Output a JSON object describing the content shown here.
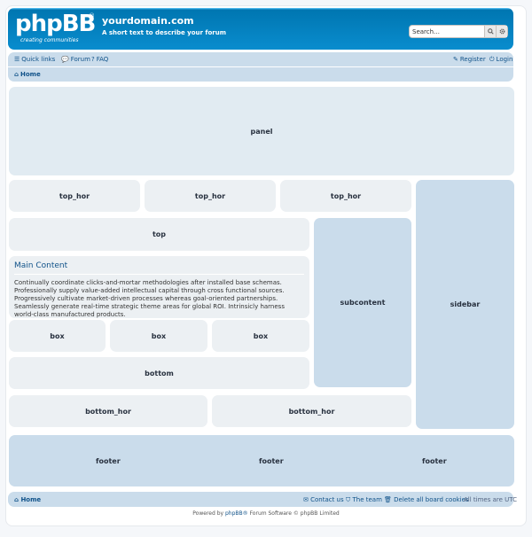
{
  "header": {
    "logo_text": "phpBB",
    "logo_reg": "®",
    "logo_tagline": "creating communities",
    "site_title": "yourdomain.com",
    "site_description": "A short text to describe your forum",
    "search_placeholder": "Search…"
  },
  "navbar": {
    "quick_links": "Quick links",
    "forum": "Forum",
    "faq": "FAQ",
    "register": "Register",
    "login": "Login",
    "home": "Home"
  },
  "blocks": {
    "panel": "panel",
    "top_hor": [
      "top_hor",
      "top_hor",
      "top_hor"
    ],
    "top": "top",
    "subcontent": "subcontent",
    "sidebar": "sidebar",
    "box": [
      "box",
      "box",
      "box"
    ],
    "bottom": "bottom",
    "bottom_hor": [
      "bottom_hor",
      "bottom_hor"
    ],
    "footer": [
      "footer",
      "footer",
      "footer"
    ]
  },
  "main": {
    "title": "Main Content",
    "text": "Continually coordinate clicks-and-mortar methodologies after installed base schemas. Professionally supply value-added intellectual capital through cross functional sources. Progressively cultivate market-driven processes whereas goal-oriented partnerships. Seamlessly generate real-time strategic theme areas for global ROI. Intrinsicly harness world-class manufactured products."
  },
  "footer_nav": {
    "home": "Home",
    "contact": "Contact us",
    "team": "The team",
    "delete_cookies": "Delete all board cookies",
    "timezone": "All times are UTC"
  },
  "copyright": {
    "prefix": "Powered by",
    "link": "phpBB®",
    "suffix": "Forum Software © phpBB Limited"
  },
  "colors": {
    "header_blue": "#12a3eb",
    "nav_blue": "#cadceb",
    "link_blue": "#105289",
    "block_gray": "#ecf0f3"
  }
}
